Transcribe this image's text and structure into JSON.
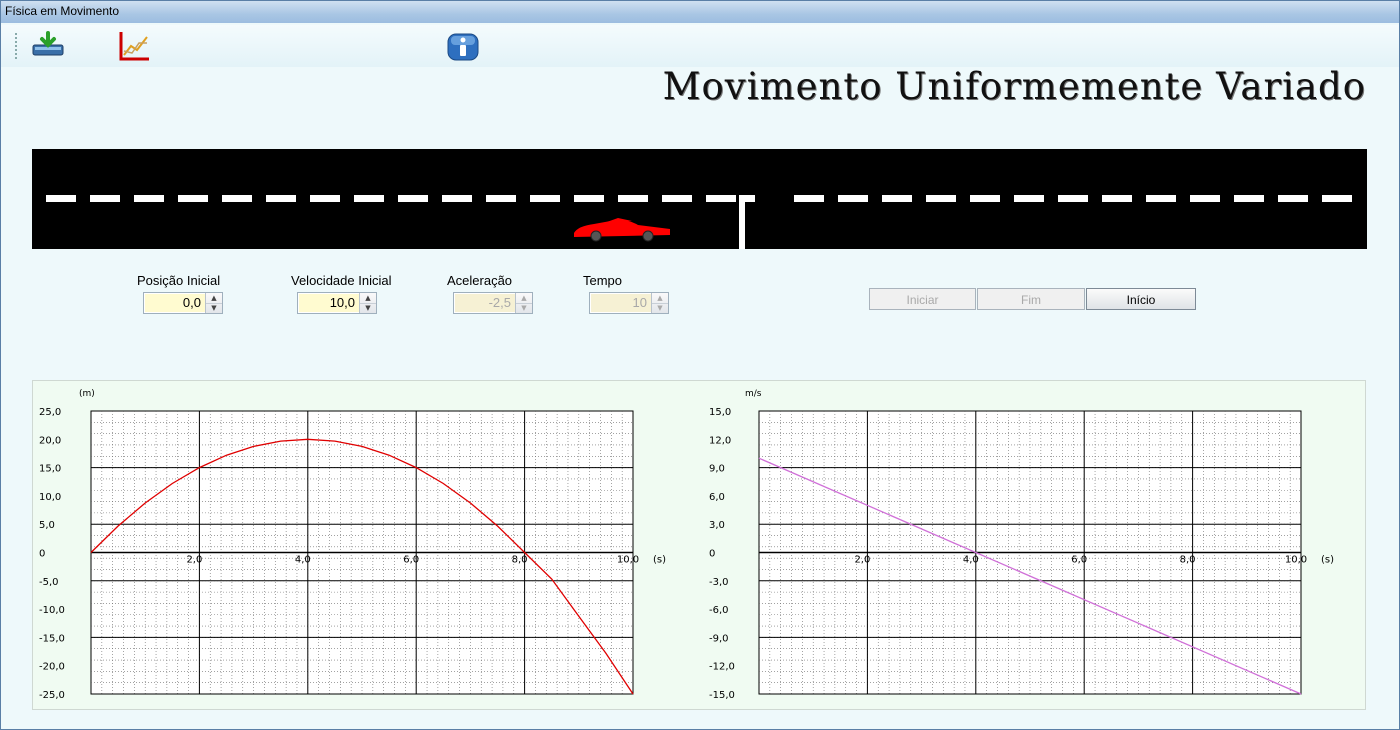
{
  "window": {
    "title": "Física em Movimento"
  },
  "toolbar": {
    "buttons": [
      {
        "name": "save",
        "icon": "download-icon"
      },
      {
        "name": "graph",
        "icon": "chart-icon"
      },
      {
        "name": "info",
        "icon": "info-icon"
      }
    ]
  },
  "heading": "Movimento Uniformemente Variado",
  "simulation": {
    "car_color": "#ff0000",
    "car_position_m": 20.0
  },
  "controls": [
    {
      "label": "Posição Inicial",
      "value": "0,0",
      "enabled": true
    },
    {
      "label": "Velocidade Inicial",
      "value": "10,0",
      "enabled": true
    },
    {
      "label": "Aceleração",
      "value": "-2,5",
      "enabled": false
    },
    {
      "label": "Tempo",
      "value": "10",
      "enabled": false
    }
  ],
  "buttons": {
    "start": "Iniciar",
    "end": "Fim",
    "reset": "Início"
  },
  "chart_data": [
    {
      "type": "line",
      "x_unit_label": "(s)",
      "y_unit_label": "(m)",
      "xlim": [
        0,
        10
      ],
      "ylim": [
        -25,
        25
      ],
      "x_ticks": [
        "2,0",
        "4,0",
        "6,0",
        "8,0",
        "10,0"
      ],
      "y_ticks": [
        "25,0",
        "20,0",
        "15,0",
        "10,0",
        "5,0",
        "0",
        "-5,0",
        "-10,0",
        "-15,0",
        "-20,0",
        "-25,0"
      ],
      "grid": true,
      "series": [
        {
          "color": "#e00000",
          "x": [
            0,
            0.5,
            1,
            1.5,
            2,
            2.5,
            3,
            3.5,
            4,
            4.5,
            5,
            5.5,
            6,
            6.5,
            7,
            7.5,
            8,
            8.5,
            9,
            9.5,
            10
          ],
          "y": [
            0,
            4.69,
            8.75,
            12.19,
            15,
            17.19,
            18.75,
            19.69,
            20,
            19.69,
            18.75,
            17.19,
            15,
            12.19,
            8.75,
            4.69,
            0,
            -4.69,
            -11.25,
            -17.81,
            -25
          ]
        }
      ]
    },
    {
      "type": "line",
      "x_unit_label": "(s)",
      "y_unit_label": "m/s",
      "xlim": [
        0,
        10
      ],
      "ylim": [
        -15,
        15
      ],
      "x_ticks": [
        "2,0",
        "4,0",
        "6,0",
        "8,0",
        "10,0"
      ],
      "y_ticks": [
        "15,0",
        "12,0",
        "9,0",
        "6,0",
        "3,0",
        "0",
        "-3,0",
        "-6,0",
        "-9,0",
        "-12,0",
        "-15,0"
      ],
      "grid": true,
      "series": [
        {
          "color": "#d070d8",
          "x": [
            0,
            10
          ],
          "y": [
            10,
            -15
          ]
        }
      ]
    }
  ]
}
